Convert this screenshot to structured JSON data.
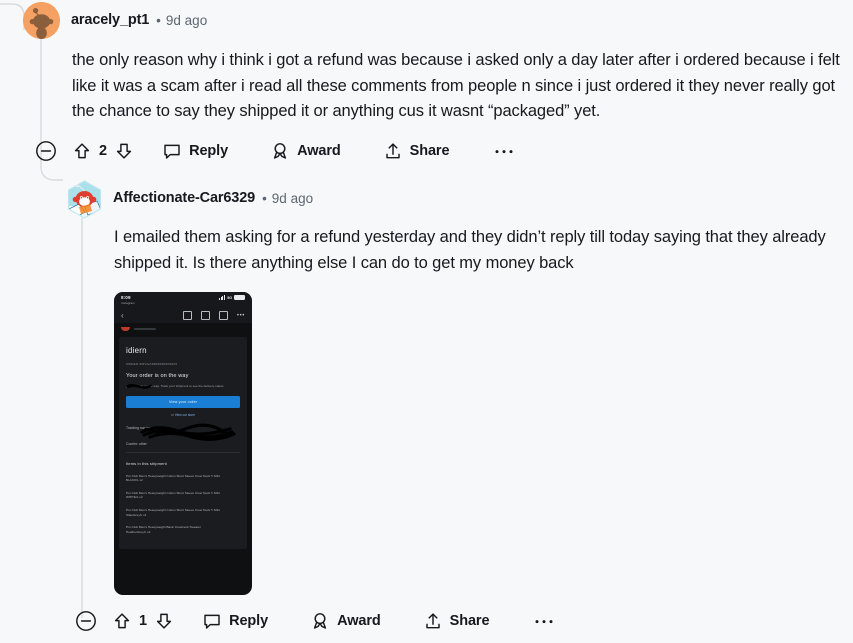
{
  "theme": {
    "background": "#f7f8fa",
    "text_primary": "#16191d",
    "text_muted": "#5c6670",
    "threadline": "#d8dbdf",
    "avatar_orange": "#f5a163",
    "snoo_brown": "#8b5e3c",
    "snoo_red": "#e03d2f",
    "cta_blue": "#1a7fd4"
  },
  "comments": [
    {
      "username": "aracely_pt1",
      "separator": "•",
      "timestamp": "9d ago",
      "avatar_icon": "snoo-circle-avatar",
      "body": "the only reason why i think i got a refund was because i asked only a day later after i ordered because i felt like it was a scam after i read all these comments from people n since i just ordered it they never really got the chance to say they shipped it or anything cus it wasnt “packaged” yet.",
      "actions": {
        "collapse_icon": "collapse-minus-icon",
        "upvote_icon": "upvote-arrow-icon",
        "vote_count": "2",
        "downvote_icon": "downvote-arrow-icon",
        "reply_icon": "comment-bubble-icon",
        "reply_label": "Reply",
        "award_icon": "award-ribbon-icon",
        "award_label": "Award",
        "share_icon": "share-upload-icon",
        "share_label": "Share",
        "more_icon": "overflow-dots-icon"
      }
    },
    {
      "username": "Affectionate-Car6329",
      "separator": "•",
      "timestamp": "9d ago",
      "avatar_icon": "snoo-hexagon-avatar",
      "body": "I emailed them asking for a refund yesterday and they didn’t reply till today saying that they already shipped it. Is there anything else I can do to get my money back",
      "actions": {
        "collapse_icon": "collapse-minus-icon",
        "upvote_icon": "upvote-arrow-icon",
        "vote_count": "1",
        "downvote_icon": "downvote-arrow-icon",
        "reply_icon": "comment-bubble-icon",
        "reply_label": "Reply",
        "award_icon": "award-ribbon-icon",
        "award_label": "Award",
        "share_icon": "share-upload-icon",
        "share_label": "Share",
        "more_icon": "overflow-dots-icon"
      }
    }
  ],
  "attachment": {
    "name": "order-shipping-email-screenshot",
    "status_bar": {
      "time": "8:09",
      "location_icon": "location-arrow-icon",
      "app_name": "Instagram",
      "signal_icon": "signal-bars-icon",
      "network": "5G",
      "battery_icon": "battery-full-icon"
    },
    "toolbar": {
      "back_icon": "chevron-left-icon",
      "archive_icon": "archive-box-icon",
      "delete_icon": "trash-icon",
      "mail_icon": "mail-icon",
      "more_icon": "overflow-dots-icon"
    },
    "email": {
      "brand": "idiern",
      "order_line": "ORDER #MVGA9909090909929",
      "headline": "Your order is on the way",
      "subtext": "your order is on the way. Track your shipment to see the delivery status.",
      "cta_label": "View your order",
      "store_prefix": "or",
      "store_link": "View our store",
      "tracking_label": "Tracking number",
      "tracking_redacted": true,
      "courier_label": "Courier: other",
      "items_header": "Items in this shipment",
      "items": [
        {
          "name": "Pro Club Men's Heavyweight Cotton Short Sleeve Crew Neck T-Shirt",
          "variant": "BLACK/L  x2"
        },
        {
          "name": "Pro Club Men's Heavyweight Cotton Short Sleeve Crew Neck T-Shirt",
          "variant": "WHITE/L  x2"
        },
        {
          "name": "Pro Club Men's Heavyweight Cotton Short Sleeve Crew Neck T-Shirt",
          "variant": "SlateGrey/L  x1"
        },
        {
          "name": "Pro Club Men's Heavyweight Basic Crewneck Sweater",
          "variant": "HeatherGrey/L  x2"
        }
      ]
    }
  }
}
